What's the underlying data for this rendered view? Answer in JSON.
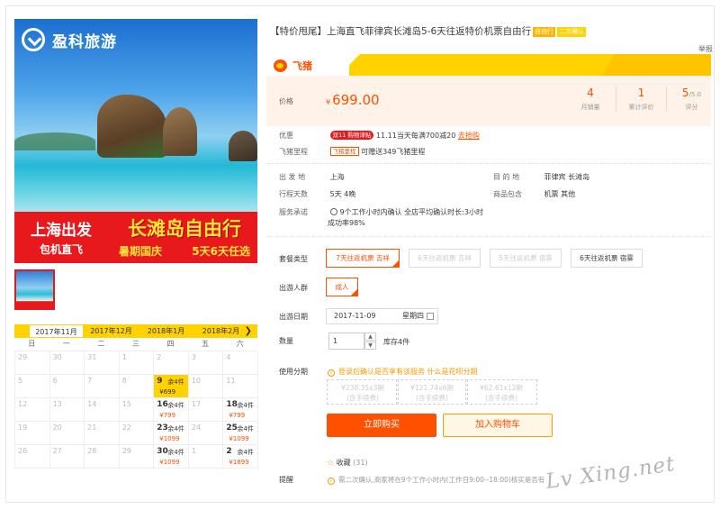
{
  "hero": {
    "brand": "盈科旅游",
    "banner_left_1": "上海出发",
    "banner_left_2": "包机直飞",
    "banner_right_1": "长滩岛自由行",
    "banner_right_2a": "暑期国庆",
    "banner_right_2b": "5天6天任选"
  },
  "calendar": {
    "months": [
      "2017年11月",
      "2017年12月",
      "2018年1月",
      "2018年2月"
    ],
    "active_month": "2017年11月",
    "weekdays": [
      "日",
      "一",
      "二",
      "三",
      "四",
      "五",
      "六"
    ],
    "cells": [
      {
        "d": "29"
      },
      {
        "d": "30"
      },
      {
        "d": "31"
      },
      {
        "d": "1"
      },
      {
        "d": "2"
      },
      {
        "d": "3"
      },
      {
        "d": "4"
      },
      {
        "d": "5"
      },
      {
        "d": "6"
      },
      {
        "d": "7"
      },
      {
        "d": "8"
      },
      {
        "d": "9",
        "rem": "余4件",
        "price": "¥699",
        "sel": true
      },
      {
        "d": "10"
      },
      {
        "d": "11"
      },
      {
        "d": "12"
      },
      {
        "d": "13"
      },
      {
        "d": "14"
      },
      {
        "d": "15"
      },
      {
        "d": "16",
        "rem": "余4件",
        "price": "¥799"
      },
      {
        "d": "17"
      },
      {
        "d": "18",
        "rem": "余4件",
        "price": "¥799"
      },
      {
        "d": "19"
      },
      {
        "d": "20"
      },
      {
        "d": "21"
      },
      {
        "d": "22"
      },
      {
        "d": "23",
        "rem": "余4件",
        "price": "¥1099"
      },
      {
        "d": "24"
      },
      {
        "d": "25",
        "rem": "余4件",
        "price": "¥1099"
      },
      {
        "d": "26"
      },
      {
        "d": "27"
      },
      {
        "d": "28"
      },
      {
        "d": "29"
      },
      {
        "d": "30",
        "rem": "余4件",
        "price": "¥1099"
      },
      {
        "d": "1"
      },
      {
        "d": "2",
        "rem": "余4件",
        "price": "¥1899"
      }
    ]
  },
  "product": {
    "title": "【特价甩尾】上海直飞菲律宾长滩岛5-6天往返特价机票自由行",
    "tag1": "自由行",
    "tag2": "二次确认",
    "report": "举报",
    "fliggy": "飞猪",
    "price_label": "价格",
    "price_currency": "¥",
    "price_value": "699.00",
    "stats": [
      {
        "value": "4",
        "label": "月销量"
      },
      {
        "value": "1",
        "label": "累计评价"
      },
      {
        "value": "5",
        "suffix": "/5.0",
        "label": "评分"
      }
    ],
    "promo_label": "优惠",
    "promo_badge": "双11 购物津贴",
    "promo_text": "11.11当天每满700减20",
    "promo_link": "去抢购",
    "mile_label": "飞猪里程",
    "mile_badge": "飞猪里程",
    "mile_text": "可赠送349飞猪里程",
    "depart_label": "出 发 地",
    "depart_value": "上海",
    "dest_label": "目 的 地",
    "dest_value": "菲律宾  长滩岛",
    "days_label": "行程天数",
    "days_value": "5天  4晚",
    "include_label": "商品包含",
    "include_value": "机票  其他",
    "service_label": "服务承诺",
    "service_line1": "9个工作小时内确认 全店平均确认时长:3小时",
    "service_line2": "成功率98%",
    "package_label": "套餐类型",
    "packages": [
      "7天往返机票 吉祥",
      "6天往返机票 吉祥",
      "5天往返机票 宿雾",
      "6天往返机票 宿雾"
    ],
    "traveler_label": "出游人群",
    "traveler_option": "成人",
    "date_label": "出游日期",
    "date_value": "2017-11-09",
    "date_weekday": "星期四",
    "qty_label": "数量",
    "qty_value": "1",
    "stock": "库存4件",
    "inst_label": "使用分期",
    "inst_notice": "登录后确认是否享有该服务",
    "inst_link": "什么是花呗分期",
    "installments": [
      {
        "amount": "¥238.35x3期",
        "note": "(含手续费)"
      },
      {
        "amount": "¥121.74x6期",
        "note": "(含手续费)"
      },
      {
        "amount": "¥62.61x12期",
        "note": "(含手续费)"
      }
    ],
    "buy_button": "立即购买",
    "cart_button": "加入购物车",
    "fav_label": "收藏",
    "fav_count": "(31)",
    "remind_label": "提醒",
    "remind_text": "需二次确认,商家将在9个工作小时内(工作日9:00--18:00)核实是否有"
  },
  "watermark": "Lv Xing.net"
}
